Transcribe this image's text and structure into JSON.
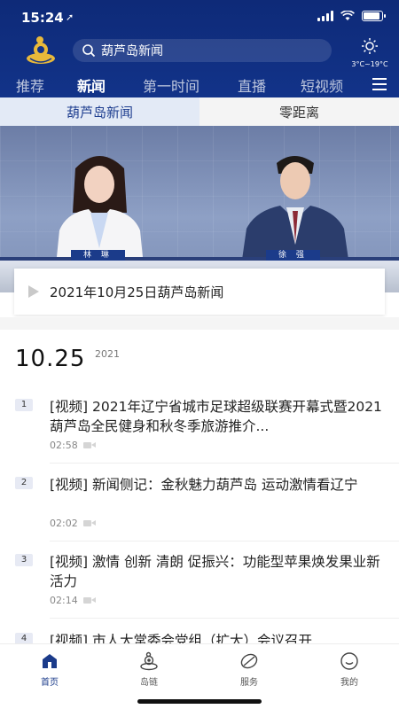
{
  "status": {
    "time": "15:24",
    "location_arrow": "➚"
  },
  "header": {
    "search_text": "葫芦岛新闻",
    "weather_temp": "3°C~19°C"
  },
  "tabs": [
    {
      "label": "推荐",
      "active": false
    },
    {
      "label": "新闻",
      "active": true
    },
    {
      "label": "第一时间",
      "active": false
    },
    {
      "label": "直播",
      "active": false
    },
    {
      "label": "短视频",
      "active": false
    }
  ],
  "subtabs": [
    {
      "label": "葫芦岛新闻",
      "active": true
    },
    {
      "label": "零距离",
      "active": false
    }
  ],
  "video": {
    "anchor_left": "林 琳",
    "anchor_right": "徐 强",
    "caption": "2021年10月25日葫芦岛新闻"
  },
  "date": {
    "day": "10.25",
    "year": "2021"
  },
  "news": [
    {
      "num": "1",
      "title": "[视频] 2021年辽宁省城市足球超级联赛开幕式暨2021葫芦岛全民健身和秋冬季旅游推介...",
      "duration": "02:58"
    },
    {
      "num": "2",
      "title": "[视频] 新闻侧记：金秋魅力葫芦岛 运动激情看辽宁",
      "duration": "02:02"
    },
    {
      "num": "3",
      "title": "[视频] 激情 创新 清朗 促振兴：功能型苹果焕发果业新活力",
      "duration": "02:14"
    },
    {
      "num": "4",
      "title": "[视频] 市人大常委会党组（扩大）会议召开",
      "duration": ""
    }
  ],
  "bottom_nav": [
    {
      "label": "首页",
      "icon": "home-icon",
      "active": true
    },
    {
      "label": "岛链",
      "icon": "island-logo-icon",
      "active": false
    },
    {
      "label": "服务",
      "icon": "leaf-icon",
      "active": false
    },
    {
      "label": "我的",
      "icon": "profile-icon",
      "active": false
    }
  ],
  "colors": {
    "header_bg": "#123389",
    "accent": "#1b3b8a",
    "logo": "#e9b93a"
  }
}
